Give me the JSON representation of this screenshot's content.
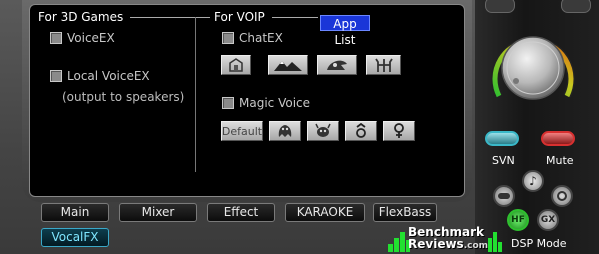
{
  "left_panel": {
    "games": {
      "title": "For 3D Games",
      "voiceex_label": "VoiceEX",
      "local_voiceex_label": "Local VoiceEX",
      "local_voiceex_sub": "(output to speakers)"
    },
    "voip": {
      "title": "For VOIP",
      "applist_label": "App List",
      "chatex_label": "ChatEX",
      "magic_voice_label": "Magic Voice",
      "default_label": "Default"
    }
  },
  "tabs": [
    {
      "label": "Main"
    },
    {
      "label": "Mixer"
    },
    {
      "label": "Effect"
    },
    {
      "label": "KARAOKE"
    },
    {
      "label": "FlexBass"
    },
    {
      "label": "VocalFX"
    }
  ],
  "right_panel": {
    "svn_label": "SVN",
    "mute_label": "Mute",
    "hf_label": "HF",
    "gx_label": "GX",
    "dsp_mode_label": "DSP Mode"
  },
  "watermark": {
    "line1": "Benchmark",
    "line2": "Reviews",
    "suffix": ".com"
  },
  "colors": {
    "applist_bg": "#1a36d8",
    "svn_ring": "#3ab8c8",
    "mute_ring": "#d83030",
    "active_tab": "#3aa8c8",
    "hf_green": "#2ec02e",
    "watermark_green": "#22e030"
  }
}
